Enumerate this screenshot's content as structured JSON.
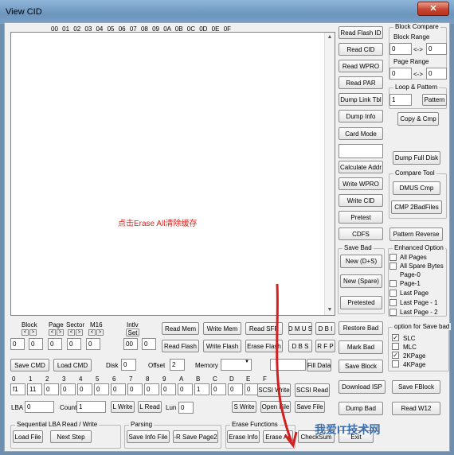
{
  "window": {
    "title": "View CID",
    "close": "✕"
  },
  "hex_header": "00 01 02 03 04 05 06 07 08 09 0A 0B 0C 0D 0E 0F",
  "overlay_note": "点击Erase All清除缓存",
  "right_col": [
    "Read Flash ID",
    "Read CID",
    "Read WPRO",
    "Read PAR",
    "Dump Link Tbl",
    "Dump Info",
    "Card Mode",
    "",
    "Calculate Addr",
    "Write WPRO",
    "Write CID",
    "Pretest",
    "CDFS"
  ],
  "block_compare": {
    "label": "Block Compare",
    "range_label": "Block Range",
    "from": "0",
    "to": "0",
    "sep": "<->"
  },
  "page_range": {
    "label": "Page Range",
    "from": "0",
    "to": "0",
    "sep": "<->"
  },
  "loop_pattern": {
    "label": "Loop & Pattern",
    "value": "1",
    "btn": "Pattern"
  },
  "copy_cmp": "Copy & Cmp",
  "dump_full": "Dump Full Disk",
  "compare_tool": {
    "label": "Compare Tool",
    "dmus": "DMUS Cmp",
    "cmp2": "CMP 2BadFiles"
  },
  "pattern_reverse": "Pattern Reverse",
  "save_bad": {
    "label": "Save Bad",
    "new_ds": "New (D+S)",
    "new_spare": "New (Spare)",
    "pretested": "Pretested"
  },
  "enhanced": {
    "label": "Enhanced Option",
    "items": [
      "All Pages",
      "All Spare Bytes",
      "Page-0",
      "Page-1",
      "Last Page",
      "Last Page - 1",
      "Last Page - 2"
    ]
  },
  "save_opts": {
    "label": "option for Save bad",
    "items": [
      {
        "t": "SLC",
        "c": "✓"
      },
      {
        "t": "MLC",
        "c": ""
      },
      {
        "t": "2KPage",
        "c": "✓"
      },
      {
        "t": "4KPage",
        "c": ""
      }
    ]
  },
  "addr": {
    "block": "Block",
    "page": "Page",
    "sector": "Sector",
    "m16": "M16",
    "intlv": "Intlv",
    "set": "Set",
    "vals": [
      "0",
      "0",
      "0",
      "0",
      "0",
      "00",
      "0"
    ],
    "arrows": [
      "<",
      ">"
    ]
  },
  "mem_btns": [
    "Read Mem",
    "Write Mem",
    "Read SFR",
    "D M U S",
    "D B I",
    "Read Flash",
    "Write Flash",
    "Erase Flash",
    "D B S",
    "R F P"
  ],
  "restore_bad": "Restore Bad",
  "mark_bad": "Mark Bad",
  "save_block": "Save Block",
  "download_isp": "Download ISP",
  "save_fblock": "Save FBlock",
  "dump_bad": "Dump Bad",
  "read_w12": "Read W12",
  "cmd": {
    "save": "Save CMD",
    "load": "Load CMD",
    "disk_label": "Disk",
    "disk": "0",
    "offset_label": "Offset",
    "offset": "2",
    "memory_label": "Memory",
    "fill": "Fill Data"
  },
  "reg_hdr": [
    "0",
    "1",
    "2",
    "3",
    "4",
    "5",
    "6",
    "7",
    "8",
    "9",
    "A",
    "B",
    "C",
    "D",
    "E",
    "F"
  ],
  "reg_vals": [
    "f1",
    "11",
    "0",
    "0",
    "0",
    "0",
    "0",
    "0",
    "0",
    "0",
    "0",
    "1",
    "0",
    "0",
    "0",
    "0"
  ],
  "scsi_write": "SCSI Write",
  "scsi_read": "SCSI Read",
  "lba": {
    "label": "LBA",
    "value": "0",
    "count_label": "Count",
    "count": "1",
    "lwrite": "L Write",
    "lread": "L Read",
    "lun_label": "Lun",
    "lun": "0",
    "swrite": "S Write",
    "open": "Open File",
    "save": "Save File"
  },
  "seq": {
    "label": "Sequential LBA Read / Write",
    "load": "Load File",
    "next": "Next Step"
  },
  "parsing": {
    "label": "Parsing",
    "save_info": "Save Info File",
    "rsave": "-R Save Page2"
  },
  "erase": {
    "label": "Erase Functions",
    "info": "Erase Info",
    "all": "Erase All"
  },
  "checksum": "CheckSum",
  "exit": "Exit",
  "watermark": "我爱IT技术网"
}
